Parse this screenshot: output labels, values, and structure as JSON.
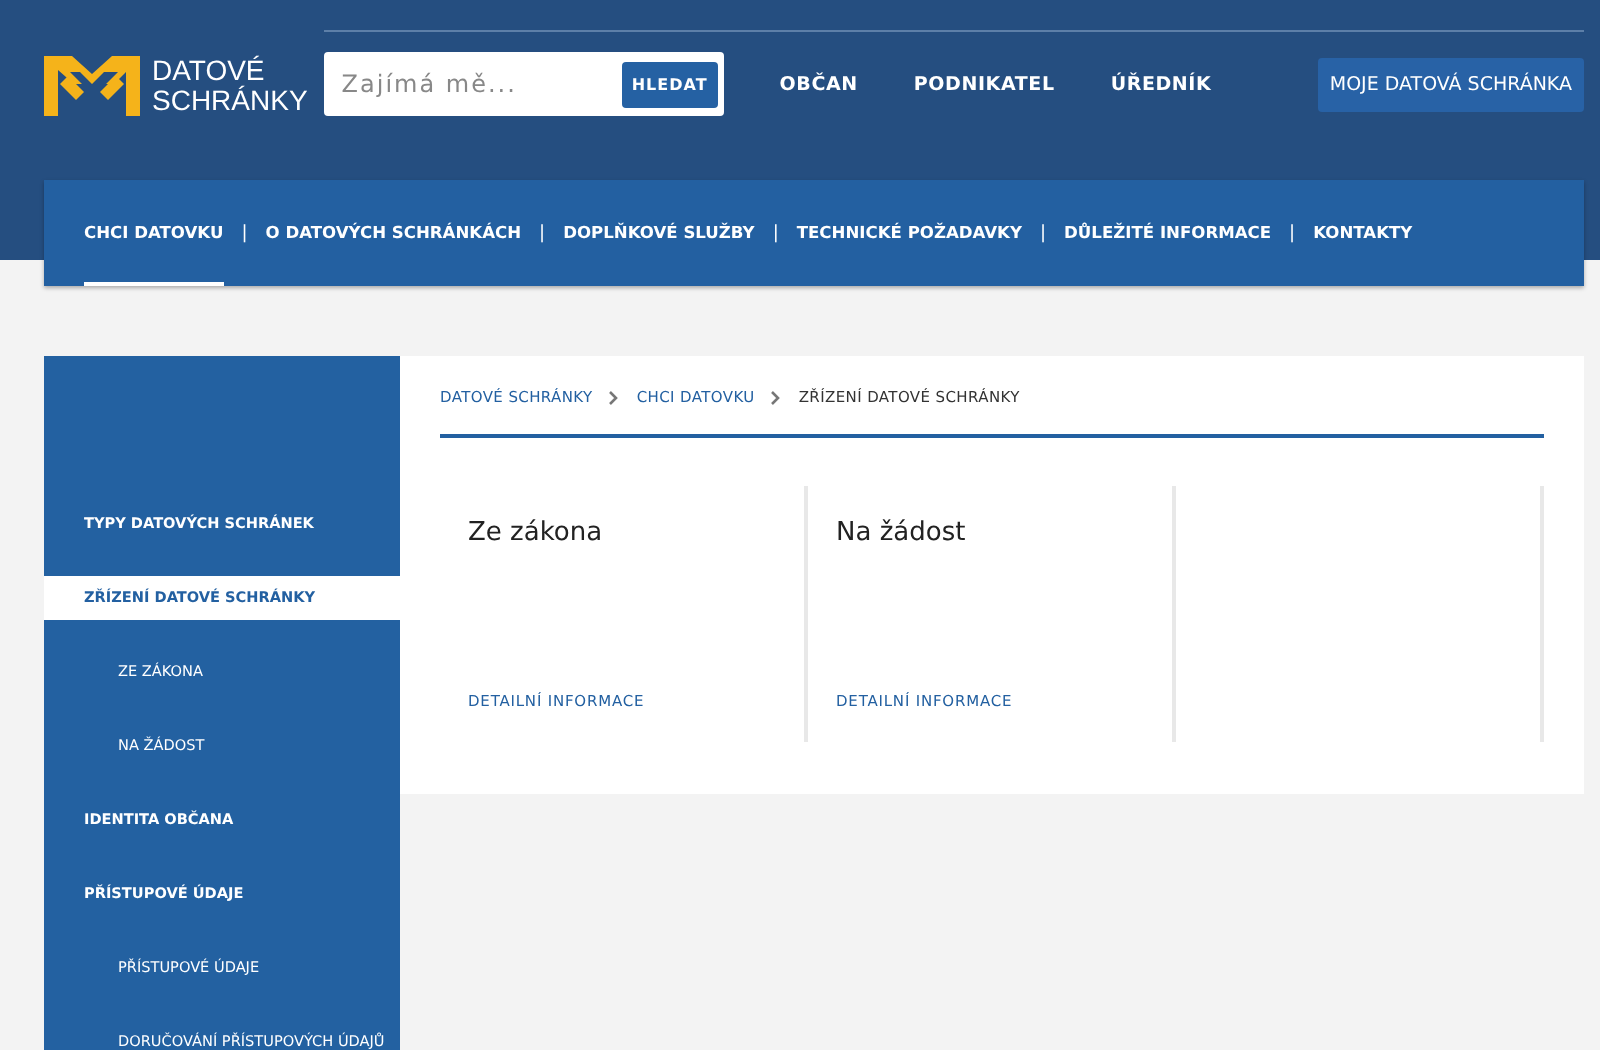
{
  "logo": {
    "lines": [
      "DATOVÉ",
      "SCHRÁNKY"
    ]
  },
  "search": {
    "placeholder": "Zajímá mě...",
    "button": "HLEDAT"
  },
  "top_nav": [
    {
      "label": "OBČAN",
      "kind": "link"
    },
    {
      "label": "PODNIKATEL",
      "kind": "link"
    },
    {
      "label": "ÚŘEDNÍK",
      "kind": "link"
    },
    {
      "label": "MOJE DATOVÁ SCHRÁNKA",
      "kind": "button"
    }
  ],
  "main_nav": [
    {
      "label": "CHCI DATOVKU",
      "selected": true,
      "separator": "|"
    },
    {
      "label": "O DATOVÝCH SCHRÁNKÁCH",
      "selected": false,
      "separator": "|"
    },
    {
      "label": "DOPLŇKOVÉ SLUŽBY",
      "selected": false,
      "separator": "|"
    },
    {
      "label": "TECHNICKÉ POŽADAVKY",
      "selected": false,
      "separator": "|"
    },
    {
      "label": "DŮLEŽITÉ INFORMACE",
      "selected": false,
      "separator": "|"
    },
    {
      "label": "KONTAKTY",
      "selected": false
    }
  ],
  "sidebar": {
    "items": [
      {
        "label": "TYPY DATOVÝCH SCHRÁNEK",
        "selected": false
      },
      {
        "label": "ZŘÍZENÍ DATOVÉ SCHRÁNKY",
        "selected": true,
        "children": [
          {
            "label": "ZE ZÁKONA",
            "selected": false
          },
          {
            "label": "NA ŽÁDOST",
            "selected": false
          }
        ]
      },
      {
        "label": "IDENTITA OBČANA",
        "selected": false
      },
      {
        "label": "PŘÍSTUPOVÉ ÚDAJE",
        "selected": false,
        "children": [
          {
            "label": "PŘÍSTUPOVÉ ÚDAJE",
            "selected": false
          },
          {
            "label": "DORUČOVÁNÍ PŘÍSTUPOVÝCH ÚDAJŮ",
            "selected": false
          }
        ]
      }
    ]
  },
  "breadcrumb": [
    "DATOVÉ SCHRÁNKY",
    "CHCI DATOVKU",
    "ZŘÍZENÍ DATOVÉ SCHRÁNKY"
  ],
  "cards": [
    {
      "title": "Ze zákona",
      "link": "DETAILNÍ INFORMACE"
    },
    {
      "title": "Na žádost",
      "link": "DETAILNÍ INFORMACE"
    }
  ]
}
